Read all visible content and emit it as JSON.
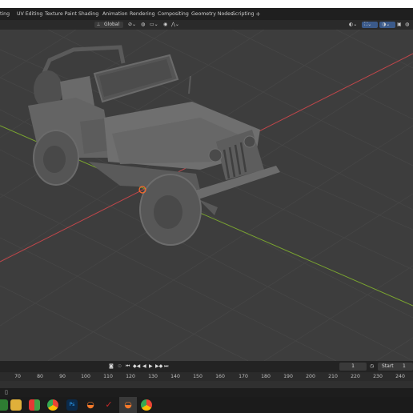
{
  "workspace_tabs": [
    {
      "label": "ting"
    },
    {
      "label": "UV Editing"
    },
    {
      "label": "Texture Paint"
    },
    {
      "label": "Shading"
    },
    {
      "label": "Animation"
    },
    {
      "label": "Rendering"
    },
    {
      "label": "Compositing"
    },
    {
      "label": "Geometry Nodes"
    },
    {
      "label": "Scripting"
    }
  ],
  "workspace_add": "+",
  "header": {
    "transform_orientation": "Global"
  },
  "timeline": {
    "current_frame": "1",
    "start_label": "Start",
    "start_value": "1"
  },
  "ruler_ticks": [
    "70",
    "80",
    "90",
    "100",
    "110",
    "120",
    "130",
    "140",
    "150",
    "160",
    "170",
    "180",
    "190",
    "200",
    "210",
    "220",
    "230",
    "240"
  ],
  "colors": {
    "x_axis": "#c0464a",
    "y_axis": "#7aa52f",
    "grid": "#474747",
    "background": "#3d3d3d",
    "playhead": "#4772b3"
  },
  "taskbar_icons": [
    "file-explorer-icon",
    "windows-store-icon",
    "chrome-icon",
    "photoshop-icon",
    "blender-icon",
    "blender-icon",
    "red-app-icon",
    "blender-active-icon",
    "chrome-icon"
  ]
}
